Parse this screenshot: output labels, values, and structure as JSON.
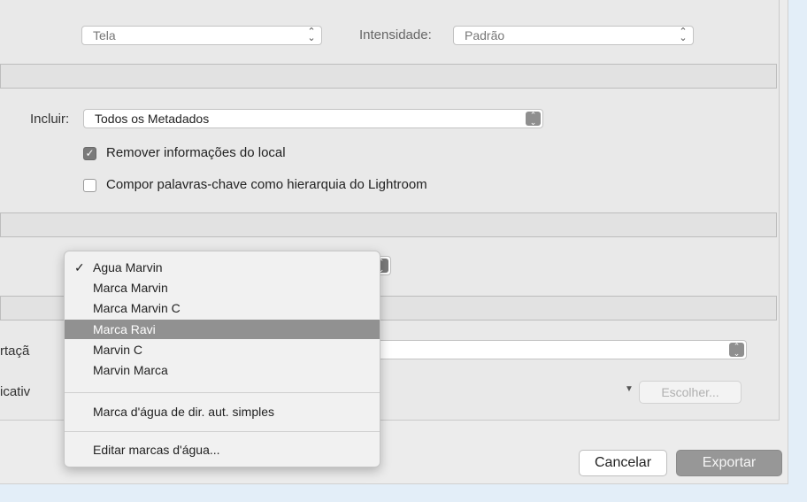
{
  "top_row": {
    "screen_value": "Tela",
    "intensity_label": "Intensidade:",
    "intensity_value": "Padrão"
  },
  "metadata": {
    "include_label": "Incluir:",
    "include_value": "Todos os Metadados",
    "remove_location_label": "Remover informações do local",
    "remove_location_checked": true,
    "compose_keywords_label": "Compor palavras-chave como hierarquia do Lightroom",
    "compose_keywords_checked": false
  },
  "watermark_menu": {
    "items": [
      {
        "label": "Agua Marvin",
        "checked": true
      },
      {
        "label": "Marca Marvin"
      },
      {
        "label": "Marca Marvin C"
      },
      {
        "label": "Marca Ravi",
        "highlighted": true
      },
      {
        "label": "Marvin C"
      },
      {
        "label": "Marvin Marca"
      }
    ],
    "simple_copyright": "Marca d'água de dir. aut. simples",
    "edit_watermarks": "Editar marcas d'água..."
  },
  "post_processing": {
    "after_export_label_partial": "rtaçã",
    "application_label_partial": "icativ",
    "choose_button": "Escolher..."
  },
  "footer": {
    "cancel": "Cancelar",
    "export": "Exportar"
  }
}
